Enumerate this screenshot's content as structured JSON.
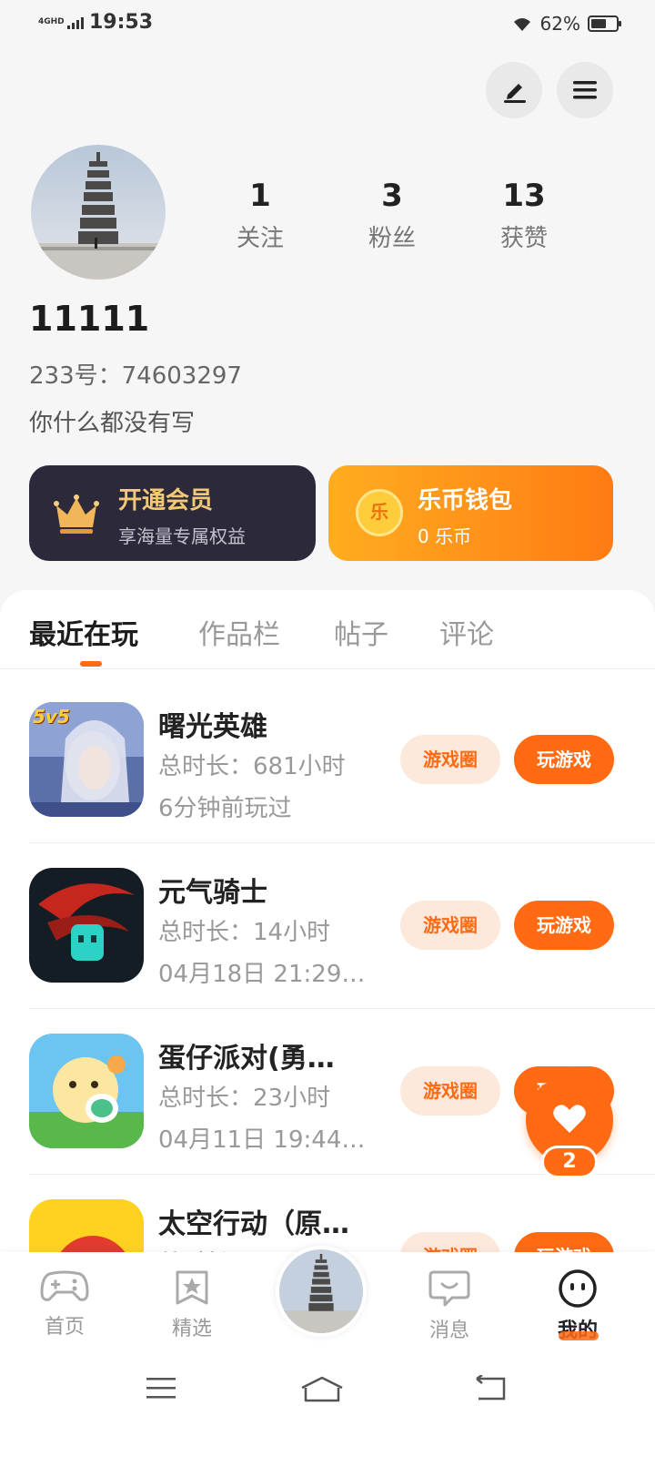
{
  "status_bar": {
    "network": "4GHD",
    "time": "19:53",
    "battery_pct": "62%",
    "battery_level": 0.62
  },
  "profile": {
    "username": "11111",
    "uid": "233号：74603297",
    "bio": "你什么都没有写",
    "stats": [
      {
        "value": "1",
        "label": "关注"
      },
      {
        "value": "3",
        "label": "粉丝"
      },
      {
        "value": "13",
        "label": "获赞"
      }
    ]
  },
  "vip_card": {
    "title": "开通会员",
    "subtitle": "享海量专属权益"
  },
  "wallet_card": {
    "title": "乐币钱包",
    "subtitle": "0 乐币",
    "coin_glyph": "乐"
  },
  "tabs": [
    "最近在玩",
    "作品栏",
    "帖子",
    "评论"
  ],
  "games": [
    {
      "name": "曙光英雄",
      "duration": "总时长：681小时",
      "last_played": "6分钟前玩过",
      "badge": "5v5",
      "circle_label": "游戏圈",
      "play_label": "玩游戏"
    },
    {
      "name": "元气骑士",
      "duration": "总时长：14小时",
      "last_played": "04月18日  21:29…",
      "circle_label": "游戏圈",
      "play_label": "玩游戏"
    },
    {
      "name": "蛋仔派对(勇…",
      "duration": "总时长：23小时",
      "last_played": "04月11日  19:44…",
      "circle_label": "游戏圈",
      "play_label": "玩游戏"
    },
    {
      "name": "太空行动（原…",
      "duration": "总时长：",
      "last_played": "",
      "circle_label": "游戏圈",
      "play_label": "玩游戏"
    }
  ],
  "fab": {
    "count": "2"
  },
  "bottom_nav": [
    {
      "label": "首页",
      "icon": "gamepad-icon"
    },
    {
      "label": "精选",
      "icon": "star-bookmark-icon"
    },
    {
      "label": "",
      "icon": "avatar"
    },
    {
      "label": "消息",
      "icon": "chat-bubble-icon"
    },
    {
      "label": "我的",
      "icon": "smiley-icon"
    }
  ],
  "colors": {
    "accent": "#ff6a13",
    "vip_bg": "#2c2a3a",
    "vip_gold": "#f3c879"
  }
}
